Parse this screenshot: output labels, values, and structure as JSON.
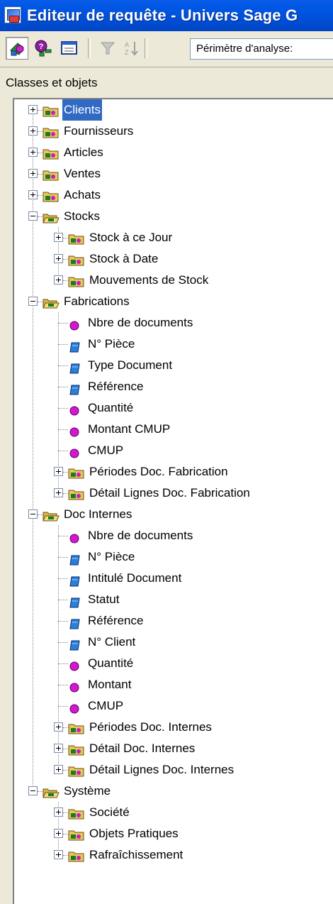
{
  "window": {
    "title": "Editeur de requête - Univers Sage G"
  },
  "toolbar": {
    "buttons": [
      {
        "name": "classes-objects-view",
        "icon": "classes-icon",
        "pressed": true
      },
      {
        "name": "conditions-view",
        "icon": "conditions-icon",
        "pressed": false
      },
      {
        "name": "properties-view",
        "icon": "properties-icon",
        "pressed": false
      },
      {
        "name": "filter",
        "icon": "filter-icon",
        "pressed": false,
        "disabled": true
      },
      {
        "name": "sort",
        "icon": "sort-icon",
        "pressed": false,
        "disabled": true
      }
    ],
    "scope_label": "Périmètre d'analyse: "
  },
  "panel": {
    "header": "Classes et objets"
  },
  "tree": [
    {
      "label": "Clients",
      "level": 0,
      "type": "folder",
      "expander": "plus",
      "selected": true
    },
    {
      "label": "Fournisseurs",
      "level": 0,
      "type": "folder",
      "expander": "plus"
    },
    {
      "label": "Articles",
      "level": 0,
      "type": "folder",
      "expander": "plus"
    },
    {
      "label": "Ventes",
      "level": 0,
      "type": "folder",
      "expander": "plus"
    },
    {
      "label": "Achats",
      "level": 0,
      "type": "folder",
      "expander": "plus"
    },
    {
      "label": "Stocks",
      "level": 0,
      "type": "folder-open",
      "expander": "minus"
    },
    {
      "label": "Stock à ce Jour",
      "level": 1,
      "type": "folder",
      "expander": "plus"
    },
    {
      "label": "Stock à Date",
      "level": 1,
      "type": "folder",
      "expander": "plus"
    },
    {
      "label": "Mouvements de Stock",
      "level": 1,
      "type": "folder",
      "expander": "plus",
      "last": true
    },
    {
      "label": "Fabrications",
      "level": 0,
      "type": "folder-open",
      "expander": "minus"
    },
    {
      "label": "Nbre de documents",
      "level": 1,
      "type": "measure"
    },
    {
      "label": "N° Pièce",
      "level": 1,
      "type": "dimension"
    },
    {
      "label": "Type Document",
      "level": 1,
      "type": "dimension"
    },
    {
      "label": "Référence",
      "level": 1,
      "type": "dimension"
    },
    {
      "label": "Quantité",
      "level": 1,
      "type": "measure"
    },
    {
      "label": "Montant CMUP",
      "level": 1,
      "type": "measure"
    },
    {
      "label": "CMUP",
      "level": 1,
      "type": "measure"
    },
    {
      "label": "Périodes Doc. Fabrication",
      "level": 1,
      "type": "folder",
      "expander": "plus"
    },
    {
      "label": "Détail Lignes Doc. Fabrication",
      "level": 1,
      "type": "folder",
      "expander": "plus",
      "last": true
    },
    {
      "label": "Doc Internes",
      "level": 0,
      "type": "folder-open",
      "expander": "minus"
    },
    {
      "label": "Nbre de documents",
      "level": 1,
      "type": "measure"
    },
    {
      "label": "N° Pièce",
      "level": 1,
      "type": "dimension"
    },
    {
      "label": "Intitulé Document",
      "level": 1,
      "type": "dimension"
    },
    {
      "label": "Statut",
      "level": 1,
      "type": "dimension"
    },
    {
      "label": "Référence",
      "level": 1,
      "type": "dimension"
    },
    {
      "label": "N° Client",
      "level": 1,
      "type": "dimension"
    },
    {
      "label": "Quantité",
      "level": 1,
      "type": "measure"
    },
    {
      "label": "Montant",
      "level": 1,
      "type": "measure"
    },
    {
      "label": "CMUP",
      "level": 1,
      "type": "measure"
    },
    {
      "label": "Périodes Doc. Internes",
      "level": 1,
      "type": "folder",
      "expander": "plus"
    },
    {
      "label": "Détail Doc. Internes",
      "level": 1,
      "type": "folder",
      "expander": "plus"
    },
    {
      "label": "Détail Lignes Doc. Internes",
      "level": 1,
      "type": "folder",
      "expander": "plus",
      "last": true
    },
    {
      "label": "Système",
      "level": 0,
      "type": "folder-open",
      "expander": "minus"
    },
    {
      "label": "Société",
      "level": 1,
      "type": "folder",
      "expander": "plus"
    },
    {
      "label": "Objets Pratiques",
      "level": 1,
      "type": "folder",
      "expander": "plus"
    },
    {
      "label": "Rafraîchissement",
      "level": 1,
      "type": "folder",
      "expander": "plus",
      "last": true
    }
  ],
  "colors": {
    "titlebar": "#0054e3",
    "selection": "#316ac5",
    "measure": "#cc00cc",
    "dimension": "#1f6fd1",
    "folder": "#e8c85a"
  }
}
